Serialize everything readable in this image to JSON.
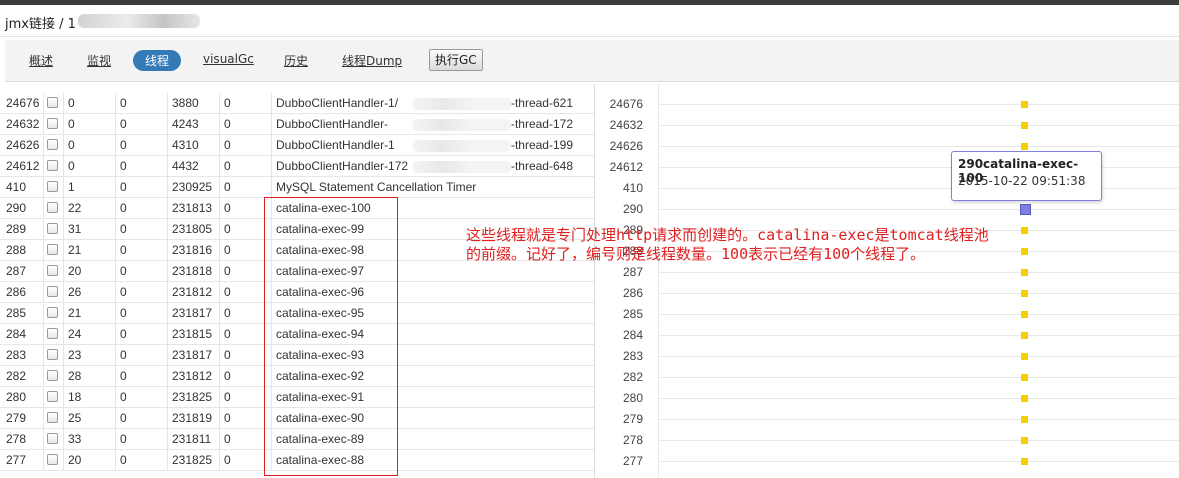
{
  "header": {
    "title": "jmx链接 / 1"
  },
  "tabs": [
    "概述",
    "监视",
    "线程",
    "visualGc",
    "历史",
    "线程Dump"
  ],
  "active_tab": "线程",
  "gc_button": "执行GC",
  "threads": [
    {
      "id": "24676",
      "a": "0",
      "b": "0",
      "c": "3880",
      "d": "0",
      "name_prefix": "DubboClientHandler-1/",
      "name_suffix": "-thread-621"
    },
    {
      "id": "24632",
      "a": "0",
      "b": "0",
      "c": "4243",
      "d": "0",
      "name_prefix": "DubboClientHandler-",
      "name_suffix": "-thread-172"
    },
    {
      "id": "24626",
      "a": "0",
      "b": "0",
      "c": "4310",
      "d": "0",
      "name_prefix": "DubboClientHandler-1",
      "name_suffix": "-thread-199"
    },
    {
      "id": "24612",
      "a": "0",
      "b": "0",
      "c": "4432",
      "d": "0",
      "name_prefix": "DubboClientHandler-172",
      "name_suffix": "-thread-648"
    },
    {
      "id": "410",
      "a": "1",
      "b": "0",
      "c": "230925",
      "d": "0",
      "name_prefix": "MySQL Statement Cancellation Timer",
      "name_suffix": ""
    },
    {
      "id": "290",
      "a": "22",
      "b": "0",
      "c": "231813",
      "d": "0",
      "name_prefix": "catalina-exec-100",
      "name_suffix": ""
    },
    {
      "id": "289",
      "a": "31",
      "b": "0",
      "c": "231805",
      "d": "0",
      "name_prefix": "catalina-exec-99",
      "name_suffix": ""
    },
    {
      "id": "288",
      "a": "21",
      "b": "0",
      "c": "231816",
      "d": "0",
      "name_prefix": "catalina-exec-98",
      "name_suffix": ""
    },
    {
      "id": "287",
      "a": "20",
      "b": "0",
      "c": "231818",
      "d": "0",
      "name_prefix": "catalina-exec-97",
      "name_suffix": ""
    },
    {
      "id": "286",
      "a": "26",
      "b": "0",
      "c": "231812",
      "d": "0",
      "name_prefix": "catalina-exec-96",
      "name_suffix": ""
    },
    {
      "id": "285",
      "a": "21",
      "b": "0",
      "c": "231817",
      "d": "0",
      "name_prefix": "catalina-exec-95",
      "name_suffix": ""
    },
    {
      "id": "284",
      "a": "24",
      "b": "0",
      "c": "231815",
      "d": "0",
      "name_prefix": "catalina-exec-94",
      "name_suffix": ""
    },
    {
      "id": "283",
      "a": "23",
      "b": "0",
      "c": "231817",
      "d": "0",
      "name_prefix": "catalina-exec-93",
      "name_suffix": ""
    },
    {
      "id": "282",
      "a": "28",
      "b": "0",
      "c": "231812",
      "d": "0",
      "name_prefix": "catalina-exec-92",
      "name_suffix": ""
    },
    {
      "id": "280",
      "a": "18",
      "b": "0",
      "c": "231825",
      "d": "0",
      "name_prefix": "catalina-exec-91",
      "name_suffix": ""
    },
    {
      "id": "279",
      "a": "25",
      "b": "0",
      "c": "231819",
      "d": "0",
      "name_prefix": "catalina-exec-90",
      "name_suffix": ""
    },
    {
      "id": "278",
      "a": "33",
      "b": "0",
      "c": "231811",
      "d": "0",
      "name_prefix": "catalina-exec-89",
      "name_suffix": ""
    },
    {
      "id": "277",
      "a": "20",
      "b": "0",
      "c": "231825",
      "d": "0",
      "name_prefix": "catalina-exec-88",
      "name_suffix": ""
    }
  ],
  "timeline_rows": [
    "24676",
    "24632",
    "24626",
    "24612",
    "410",
    "290",
    "289",
    "288",
    "287",
    "286",
    "285",
    "284",
    "283",
    "282",
    "280",
    "279",
    "278",
    "277"
  ],
  "timeline_selected": "290",
  "tooltip": {
    "title": "290catalina-exec-100",
    "time": "2015-10-22 09:51:38"
  },
  "annotation": {
    "line1": "这些线程就是专门处理http请求而创建的。catalina-exec是tomcat线程池",
    "line2": "的前缀。记好了，编号则是线程数量。100表示已经有100个线程了。"
  },
  "colors": {
    "tab_active": "#337ab7",
    "marker": "#f5d000",
    "marker_selected": "#7f7fe0",
    "annotation": "#e02020"
  }
}
